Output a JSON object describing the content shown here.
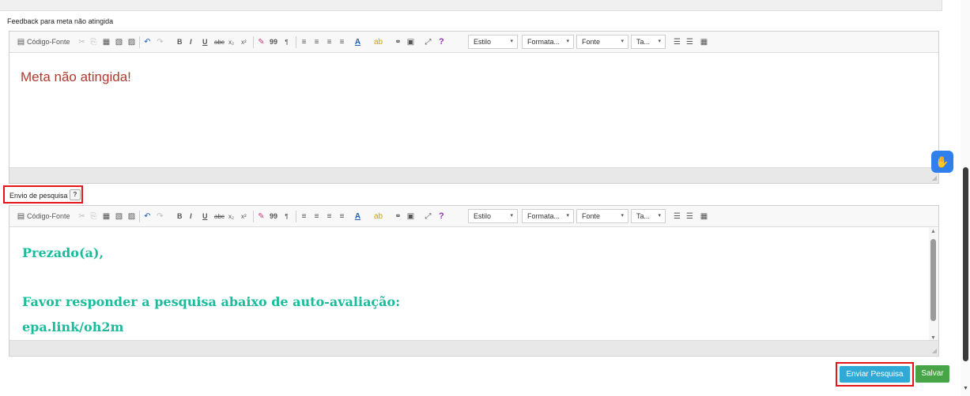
{
  "sections": {
    "feedback_label": "Feedback para meta não atingida",
    "envio_label": "Envio de pesquisa",
    "help_label": "?"
  },
  "toolbar": {
    "source_label": "Código-Fonte",
    "bold": "B",
    "italic": "I",
    "underline": "U",
    "strike": "abc",
    "subscript": "x₂",
    "superscript": "x²",
    "quote": "99",
    "help": "?",
    "style_label": "Estilo",
    "format_label": "Formata...",
    "font_label": "Fonte",
    "size_label": "Ta..."
  },
  "editor1": {
    "text": "Meta não atingida!"
  },
  "editor2": {
    "line1": "Prezado(a),",
    "line2": "Favor responder a pesquisa abaixo de auto-avaliação:",
    "line3": "epa.link/oh2m"
  },
  "buttons": {
    "enviar": "Enviar Pesquisa",
    "salvar": "Salvar"
  },
  "colors": {
    "accent_blue": "#2fa9d6",
    "save_green": "#47a447",
    "highlight_red": "#e3161c",
    "text_red": "#b03a2e",
    "text_green": "#1abc9c"
  }
}
